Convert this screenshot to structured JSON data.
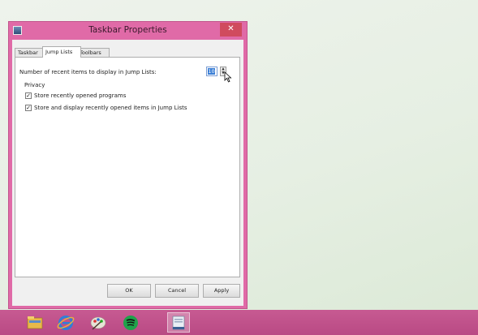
{
  "dialog": {
    "title": "Taskbar Properties",
    "close_glyph": "✕",
    "tabs": [
      {
        "label": "Taskbar",
        "active": false
      },
      {
        "label": "Jump Lists",
        "active": true
      },
      {
        "label": "Toolbars",
        "active": false
      }
    ],
    "jump_lists": {
      "recent_items_label": "Number of recent items to display in Jump Lists:",
      "recent_items_value": "10",
      "privacy_group_label": "Privacy",
      "options": [
        {
          "label": "Store recently opened programs",
          "checked": true
        },
        {
          "label": "Store and display recently opened items in Jump Lists",
          "checked": true
        }
      ]
    },
    "buttons": {
      "ok": "OK",
      "cancel": "Cancel",
      "apply": "Apply"
    }
  },
  "taskbar": {
    "color": "#c75a92",
    "items": [
      {
        "name": "file-explorer-icon"
      },
      {
        "name": "internet-explorer-icon"
      },
      {
        "name": "paint-icon"
      },
      {
        "name": "spotify-icon"
      },
      {
        "name": "taskbar-properties-icon",
        "active": true
      }
    ]
  },
  "colors": {
    "window_frame": "#e06aa7",
    "close_button": "#d04b5e",
    "selection": "#3b7fd6"
  }
}
